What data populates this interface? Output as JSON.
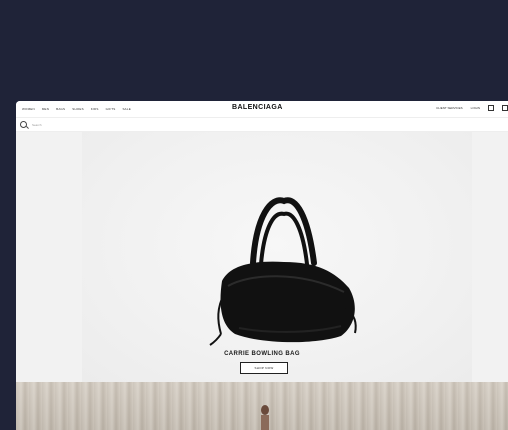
{
  "nav": {
    "left_items": [
      "WOMEN",
      "MEN",
      "BAGS",
      "SHOES",
      "KIDS",
      "GIFTS",
      "SALE"
    ],
    "brand": "BALENCIAGA",
    "right_items": [
      "CLIENT SERVICES",
      "LOGIN"
    ]
  },
  "search": {
    "placeholder": "Search"
  },
  "hero": {
    "product_title": "CARRIE BOWLING BAG",
    "cta_label": "SHOP NOW"
  },
  "colors": {
    "backdrop": "#1f2338",
    "page": "#ffffff",
    "hero_bg": "#f2f2f2",
    "bag": "#111111"
  },
  "icons": [
    "search-icon",
    "bag-icon",
    "account-icon"
  ]
}
